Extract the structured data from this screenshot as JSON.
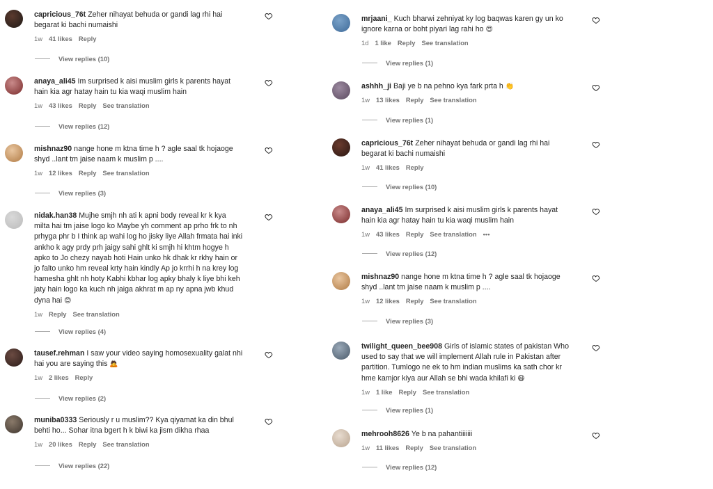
{
  "left": [
    {
      "user": "capricious_76t",
      "text": "Zeher nihayat behuda or gandi lag rhi hai begarat ki bachi numaishi",
      "time": "1w",
      "likes": "41 likes",
      "reply": "Reply",
      "translate": "",
      "more": "",
      "view": "View replies (10)",
      "emoji": ""
    },
    {
      "user": "anaya_ali45",
      "text": "Im surprised k aisi muslim girls k parents hayat hain kia agr hatay hain tu kia waqi muslim hain",
      "time": "1w",
      "likes": "43 likes",
      "reply": "Reply",
      "translate": "See translation",
      "more": "",
      "view": "View replies (12)",
      "emoji": ""
    },
    {
      "user": "mishnaz90",
      "text": "nange hone m ktna time h ? agle saal tk hojaoge shyd ..lant tm jaise naam k muslim p ....",
      "time": "1w",
      "likes": "12 likes",
      "reply": "Reply",
      "translate": "See translation",
      "more": "",
      "view": "View replies (3)",
      "emoji": ""
    },
    {
      "user": "nidak.han38",
      "text": "Mujhe smjh nh ati k apni body reveal kr k kya milta hai tm jaise logo ko Maybe yh comment ap prho frk to nh prhyga phr b I think ap wahi log ho jisky liye Allah frmata hai inki ankho k agy prdy prh jaigy sahi ghlt ki smjh hi khtm hogye h apko to Jo chezy nayab hoti Hain unko hk dhak kr rkhy hain or jo falto unko hm reveal krty hain kindly Ap jo krrhi h na krey log hamesha ghlt nh hoty Kabhi kbhar log apky bhaly k liye bhi keh jaty hain logo ka kuch nh jaiga akhrat m ap ny apna jwb khud dyna hai",
      "time": "1w",
      "likes": "",
      "reply": "Reply",
      "translate": "See translation",
      "more": "",
      "view": "View replies (4)",
      "emoji": "😊"
    },
    {
      "user": "tausef.rehman",
      "text": "I saw your video saying homosexuality galat nhi hai you are saying this",
      "time": "1w",
      "likes": "2 likes",
      "reply": "Reply",
      "translate": "",
      "more": "",
      "view": "View replies (2)",
      "emoji": "🙇"
    },
    {
      "user": "muniba0333",
      "text": "Seriously r u muslim?? Kya qiyamat ka din bhul behti ho... Sohar itna bgert h k biwi ka jism dikha rhaa",
      "time": "1w",
      "likes": "20 likes",
      "reply": "Reply",
      "translate": "See translation",
      "more": "",
      "view": "View replies (22)",
      "emoji": ""
    }
  ],
  "right": [
    {
      "user": "mrjaani_",
      "text": "Kuch bharwi zehniyat ky log baqwas karen gy un ko ignore karna or boht piyari lag rahi ho",
      "time": "1d",
      "likes": "1 like",
      "reply": "Reply",
      "translate": "See translation",
      "more": "",
      "view": "View replies (1)",
      "emoji": "😍"
    },
    {
      "user": "ashhh_ji",
      "text": "Baji ye b na pehno kya fark prta h",
      "time": "1w",
      "likes": "13 likes",
      "reply": "Reply",
      "translate": "See translation",
      "more": "",
      "view": "View replies (1)",
      "emoji": "👏"
    },
    {
      "user": "capricious_76t",
      "text": "Zeher nihayat behuda or gandi lag rhi hai begarat ki bachi numaishi",
      "time": "1w",
      "likes": "41 likes",
      "reply": "Reply",
      "translate": "",
      "more": "",
      "view": "View replies (10)",
      "emoji": ""
    },
    {
      "user": "anaya_ali45",
      "text": "Im surprised k aisi muslim girls k parents hayat hain kia agr hatay hain tu kia waqi muslim hain",
      "time": "1w",
      "likes": "43 likes",
      "reply": "Reply",
      "translate": "See translation",
      "more": "•••",
      "view": "View replies (12)",
      "emoji": ""
    },
    {
      "user": "mishnaz90",
      "text": "nange hone m ktna time h ? agle saal tk hojaoge shyd ..lant tm jaise naam k muslim p ....",
      "time": "1w",
      "likes": "12 likes",
      "reply": "Reply",
      "translate": "See translation",
      "more": "",
      "view": "View replies (3)",
      "emoji": ""
    },
    {
      "user": "twilight_queen_bee908",
      "text": "Girls of islamic states of pakistan Who used to say that we will implement Allah rule in Pakistan after partition. Tumlogo ne ek to hm indian muslims ka sath chor kr hme kamjor kiya aur Allah se bhi wada khilafi ki",
      "time": "1w",
      "likes": "1 like",
      "reply": "Reply",
      "translate": "See translation",
      "more": "",
      "view": "View replies (1)",
      "emoji": "😷"
    },
    {
      "user": "mehrooh8626",
      "text": "Ye b na pahantiiiiiii",
      "time": "1w",
      "likes": "11 likes",
      "reply": "Reply",
      "translate": "See translation",
      "more": "",
      "view": "View replies (12)",
      "emoji": ""
    }
  ],
  "colors": {
    "text": "#262626",
    "muted": "#737373",
    "line": "#a8a8a8"
  },
  "icons": {
    "like": "heart-outline-icon"
  }
}
